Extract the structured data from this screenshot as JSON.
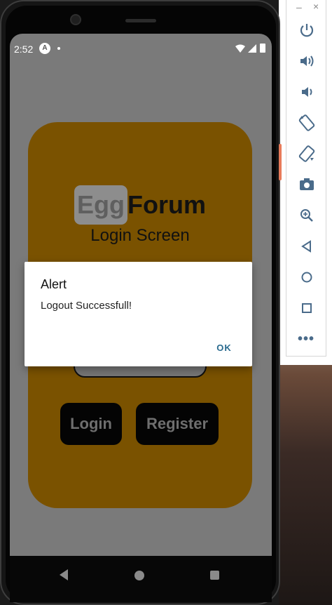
{
  "status_bar": {
    "time": "2:52",
    "notification_icon": "A"
  },
  "app": {
    "logo_egg": "Egg",
    "logo_forum": "Forum",
    "screen_title": "Login Screen",
    "login_label": "Login",
    "register_label": "Register",
    "card_color": "#7a5200"
  },
  "dialog": {
    "title": "Alert",
    "message": "Logout Successfull!",
    "ok_label": "OK"
  },
  "emulator_toolbar": {
    "window_minimize": "–",
    "window_close": "×",
    "icons": [
      "power-icon",
      "volume-up-icon",
      "volume-down-icon",
      "rotate-left-icon",
      "rotate-right-icon",
      "camera-icon",
      "zoom-icon",
      "back-icon",
      "home-icon",
      "overview-icon",
      "more-icon"
    ],
    "more_label": "•••"
  }
}
